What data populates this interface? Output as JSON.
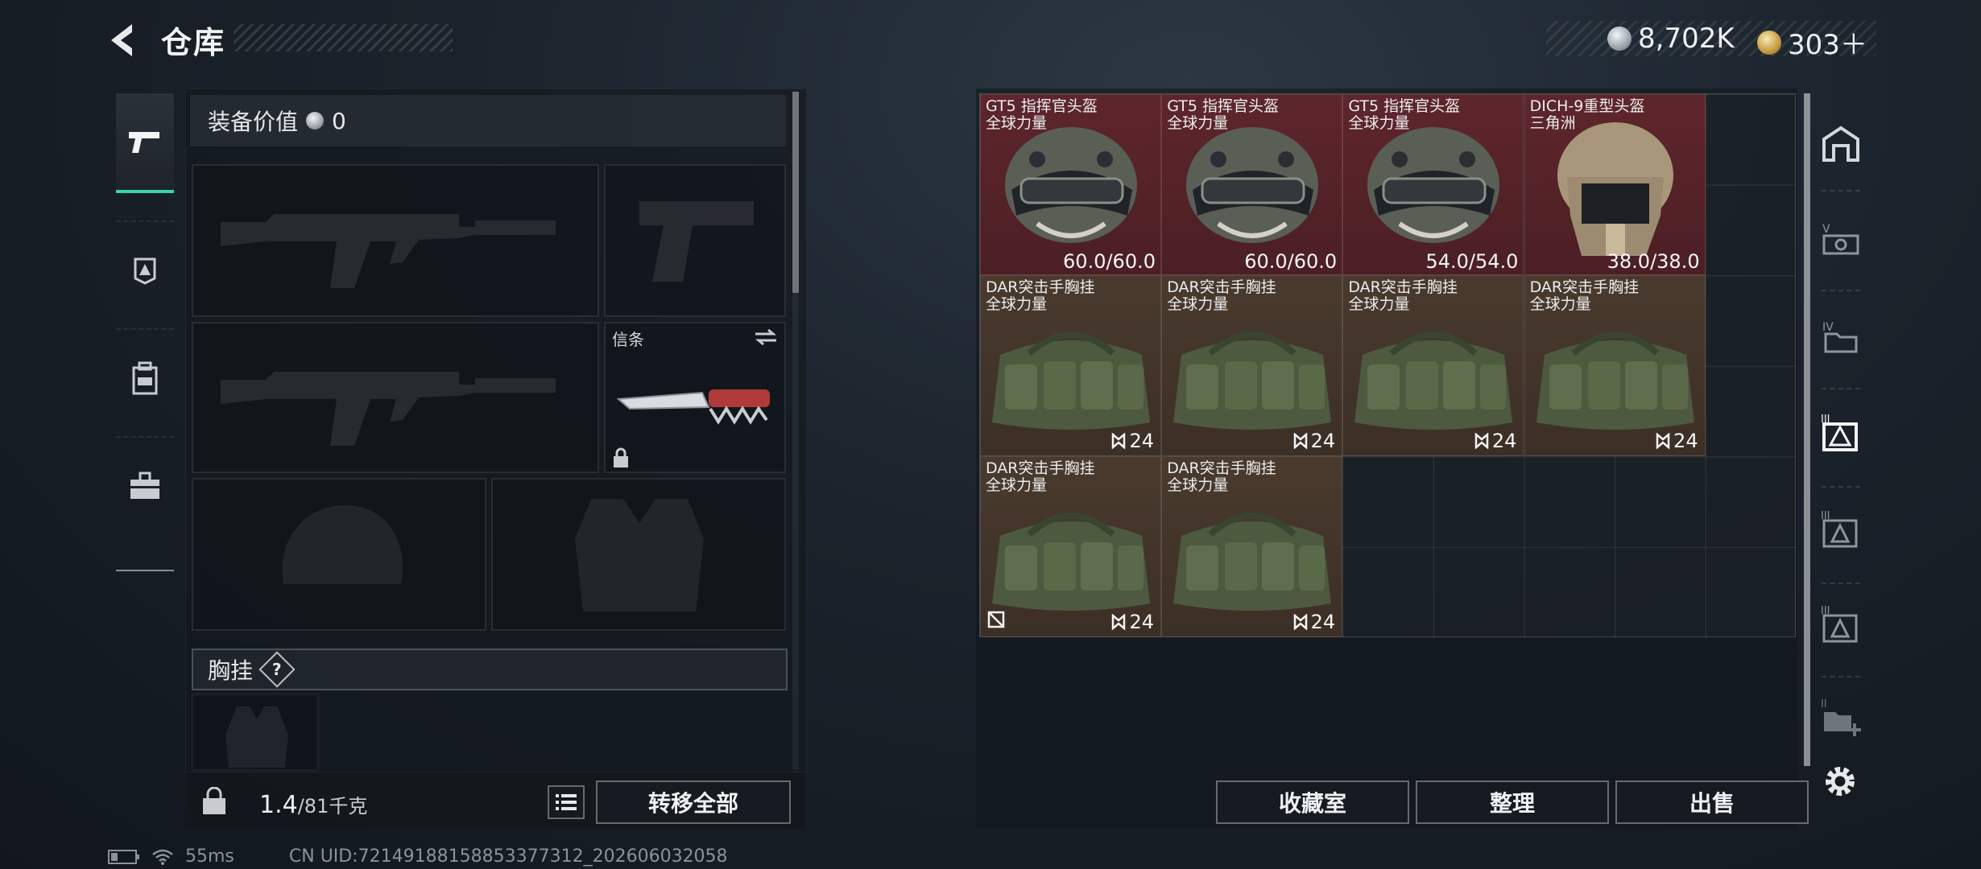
{
  "header": {
    "title": "仓库",
    "currency": [
      {
        "icon": "silver-coin-icon",
        "amount": "8,702K"
      },
      {
        "icon": "gold-coin-icon",
        "amount": "303＋"
      }
    ]
  },
  "left_nav": [
    {
      "id": "weapons",
      "icon": "pistol-icon",
      "active": true
    },
    {
      "id": "armor",
      "icon": "armor-shield-icon",
      "active": false
    },
    {
      "id": "backpack",
      "icon": "backpack-icon",
      "active": false
    },
    {
      "id": "toolbox",
      "icon": "toolbox-icon",
      "active": false
    }
  ],
  "loadout": {
    "equip_value_label": "装备价值",
    "equip_value": "0",
    "melee_label": "信条",
    "section_label": "胸挂",
    "section_help": "?",
    "weight": "1.4",
    "weight_max": "/81千克",
    "transfer_all": "转移全部"
  },
  "stash": {
    "items": [
      {
        "kind": "helmet",
        "name_line1": "GT5 指挥官头盔",
        "name_line2": "全球力量",
        "value": "60.0/60.0"
      },
      {
        "kind": "helmet",
        "name_line1": "GT5 指挥官头盔",
        "name_line2": "全球力量",
        "value": "60.0/60.0"
      },
      {
        "kind": "helmet",
        "name_line1": "GT5 指挥官头盔",
        "name_line2": "全球力量",
        "value": "54.0/54.0"
      },
      {
        "kind": "helmet-dich",
        "name_line1": "DICH-9重型头盔",
        "name_line2": "三角洲",
        "value": "38.0/38.0"
      },
      {
        "kind": "rig",
        "name_line1": "DAR突击手胸挂",
        "name_line2": "全球力量",
        "value": "24"
      },
      {
        "kind": "rig",
        "name_line1": "DAR突击手胸挂",
        "name_line2": "全球力量",
        "value": "24"
      },
      {
        "kind": "rig",
        "name_line1": "DAR突击手胸挂",
        "name_line2": "全球力量",
        "value": "24"
      },
      {
        "kind": "rig",
        "name_line1": "DAR突击手胸挂",
        "name_line2": "全球力量",
        "value": "24"
      },
      {
        "kind": "rig",
        "name_line1": "DAR突击手胸挂",
        "name_line2": "全球力量",
        "value": "24"
      },
      {
        "kind": "rig",
        "name_line1": "DAR突击手胸挂",
        "name_line2": "全球力量",
        "value": "24"
      }
    ],
    "buttons": {
      "collection": "收藏室",
      "sort": "整理",
      "sell": "出售"
    }
  },
  "status_bar": {
    "ping": "55ms",
    "uid": "CN UID:72149188158853377312_202606032058"
  },
  "colors": {
    "accent": "#3ad3a6",
    "helmet_bg": "#5e262c",
    "rig_bg": "#4a3a2e"
  }
}
